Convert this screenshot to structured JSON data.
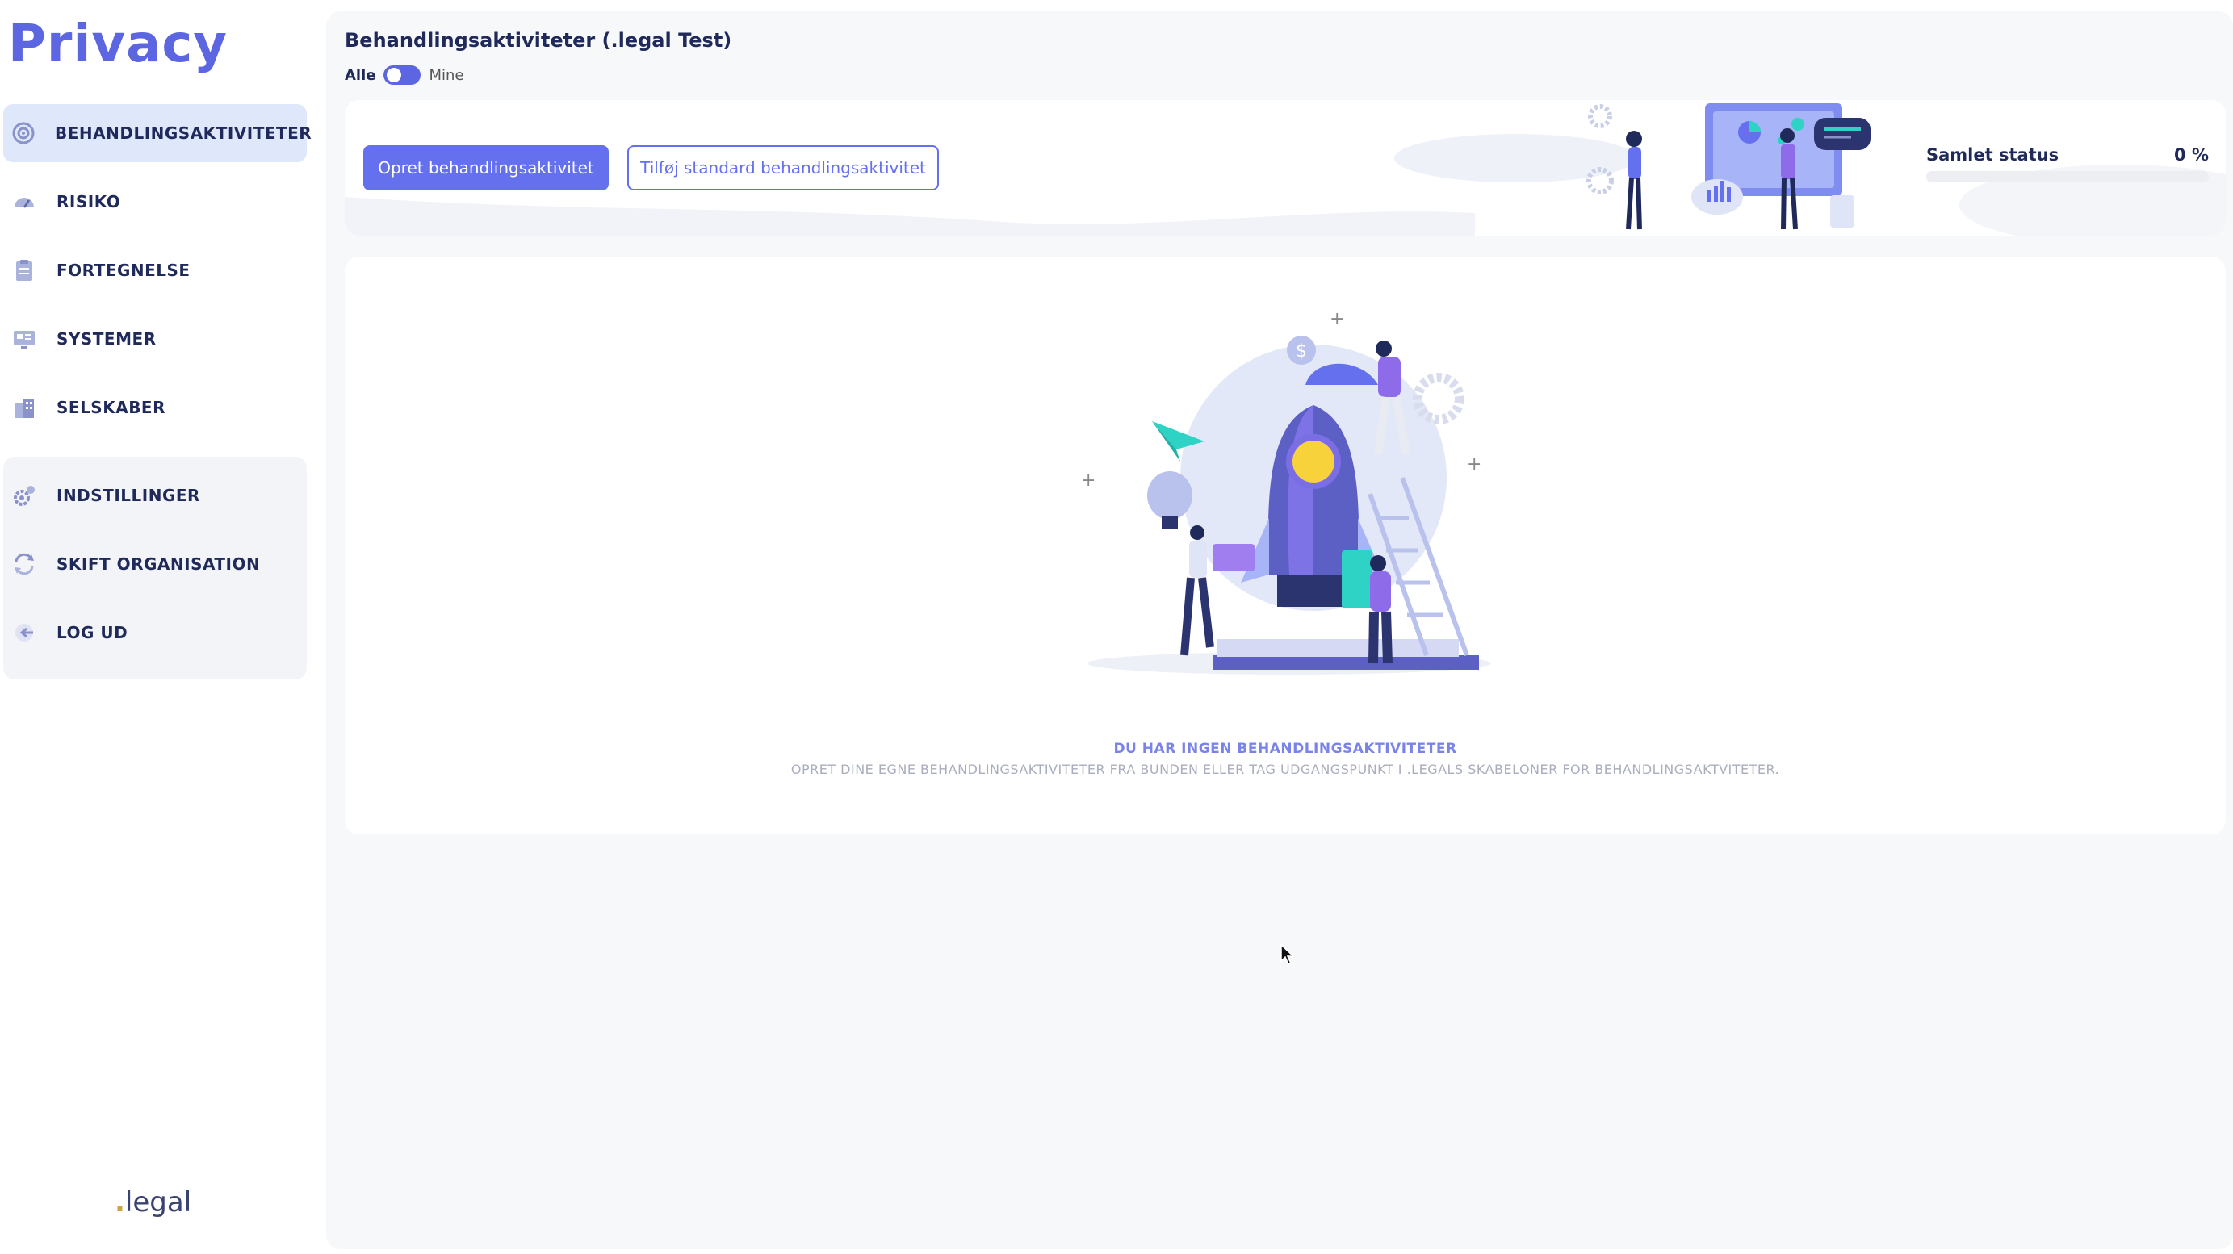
{
  "app": {
    "logo": "Privacy",
    "brand": "legal",
    "brand_dot": "."
  },
  "sidebar": {
    "items": [
      {
        "label": "BEHANDLINGSAKTIVITETER",
        "icon": "target-icon",
        "active": true
      },
      {
        "label": "RISIKO",
        "icon": "gauge-icon"
      },
      {
        "label": "FORTEGNELSE",
        "icon": "clipboard-icon"
      },
      {
        "label": "SYSTEMER",
        "icon": "monitor-icon"
      },
      {
        "label": "SELSKABER",
        "icon": "building-icon"
      }
    ],
    "group": [
      {
        "label": "INDSTILLINGER",
        "icon": "gear-icon"
      },
      {
        "label": "SKIFT ORGANISATION",
        "icon": "switch-arrows-icon"
      },
      {
        "label": "LOG UD",
        "icon": "logout-icon"
      }
    ]
  },
  "header": {
    "title": "Behandlingsaktiviteter (.legal Test)",
    "toggle": {
      "left_label": "Alle",
      "right_label": "Mine"
    }
  },
  "banner": {
    "create_button": "Opret behandlingsaktivitet",
    "add_standard_button": "Tilføj standard behandlingsaktivitet",
    "status_label": "Samlet status",
    "status_value": "0 %",
    "status_progress": 0
  },
  "empty_state": {
    "title": "DU HAR INGEN BEHANDLINGSAKTIVITETER",
    "subtitle": "OPRET DINE EGNE BEHANDLINGSAKTIVITETER FRA BUNDEN ELLER TAG UDGANGSPUNKT I .LEGALS SKABELONER FOR BEHANDLINGSAKTVITETER."
  },
  "colors": {
    "accent": "#6470ee",
    "navy": "#1f2a5a",
    "active_bg": "#dfe7fb"
  }
}
